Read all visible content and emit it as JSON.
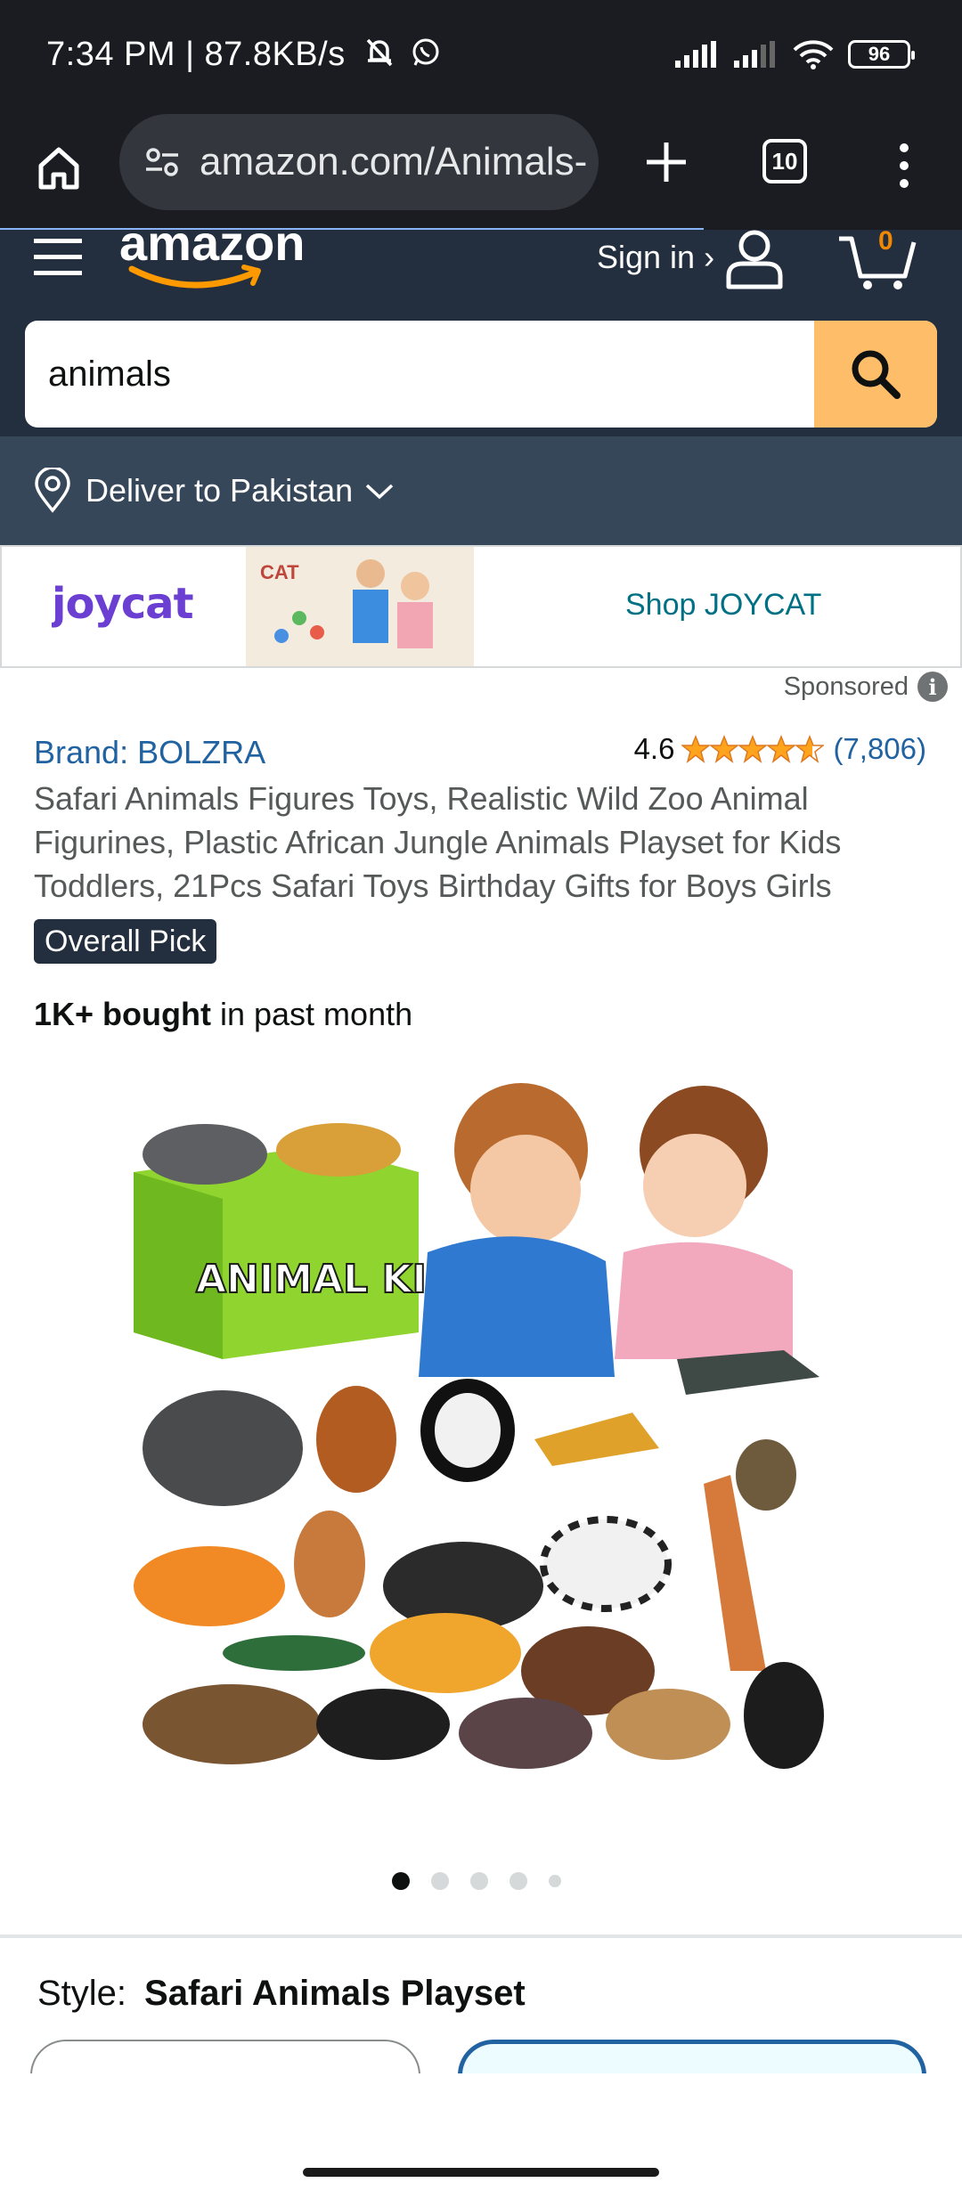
{
  "status_bar": {
    "time_speed": "7:34 PM | 87.8KB/s",
    "battery": "96"
  },
  "browser": {
    "url": "amazon.com/Animals-",
    "tab_count": "10"
  },
  "header": {
    "logo": "amazon",
    "sign_in": "Sign in ›",
    "cart_count": "0",
    "search_value": "animals"
  },
  "deliver": {
    "label": "Deliver to Pakistan"
  },
  "sponsored": {
    "brand_logo": "joycat",
    "cta": "Shop JOYCAT",
    "label": "Sponsored",
    "image_text": "CAT"
  },
  "product": {
    "brand": "Brand: BOLZRA",
    "rating": "4.6",
    "stars": 4.6,
    "review_count": "(7,806)",
    "title": "Safari Animals Figures Toys, Realistic Wild Zoo Animal Figurines, Plastic African Jungle Animals Playset for Kids Toddlers, 21Pcs Safari Toys Birthday Gifts for Boys Girls",
    "badge": "Overall Pick",
    "bought_bold": "1K+ bought",
    "bought_rest": " in past month",
    "image_text": "ANIMAL KINGDOM",
    "carousel_active_index": 0,
    "carousel_count": 5
  },
  "style": {
    "label": "Style:",
    "value": "Safari Animals Playset"
  },
  "colors": {
    "amazon_navy": "#232f3e",
    "deliver_bar": "#37475a",
    "search_button": "#febd69",
    "link_blue": "#2162a1",
    "star_orange": "#ffa41c"
  }
}
